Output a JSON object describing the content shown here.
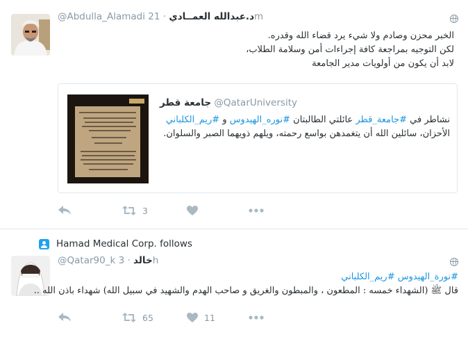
{
  "tweet1": {
    "handle": "@Abdulla_Alamadi",
    "name": "د.عبدالله العمــادي",
    "time": "· 21m",
    "lines": [
      "الخبر محزن وصادم ولا شيء يرد قضاء الله وقدره.",
      "لكن التوجيه بمراجعة كافة إجراءات أمن وسلامة الطلاب،",
      "لابد أن يكون من أولويات مدير الجامعة"
    ],
    "quote": {
      "handle": "@QatarUniversity",
      "name": "جامعة قطر",
      "line1_pre": "نشاطر في ",
      "line1_tag1": "#جامعة_قطر",
      "line1_mid": " عائلتي الطالبتان ",
      "line1_tag2": "#نوره_الهيدوس",
      "line1_and": " و ",
      "line1_tag3": "#ريم_الكلباني",
      "line2": "الأحزان، سائلين الله أن يتغمدهن بواسع رحمته، ويلهم ذويهما الصبر والسلوان."
    },
    "actions": {
      "reply_icon": "reply-icon",
      "retweet_icon": "retweet-icon",
      "retweet_count": "3",
      "like_icon": "heart-icon",
      "like_count": "",
      "more_icon": "more-icon"
    }
  },
  "tweet2": {
    "follow_context": "Hamad Medical Corp. follows",
    "handle": "@Qatar90_k",
    "name": "خالد",
    "time": "· 3h",
    "tags_line": "#نورة_الهيدوس #ريم_الكلباني",
    "body_line": "قال ﷺ (الشهداء خمسه : المطعون ، والمبطون والغريق و صاحب الهدم والشهيد في سبيل الله) شهداء باذن الله ..",
    "actions": {
      "reply_icon": "reply-icon",
      "retweet_icon": "retweet-icon",
      "retweet_count": "65",
      "like_icon": "heart-icon",
      "like_count": "11",
      "more_icon": "more-icon"
    }
  },
  "colors": {
    "link": "#1b95e0",
    "muted": "#8899a6",
    "text": "#292f33",
    "divider": "#e1e8ed"
  }
}
